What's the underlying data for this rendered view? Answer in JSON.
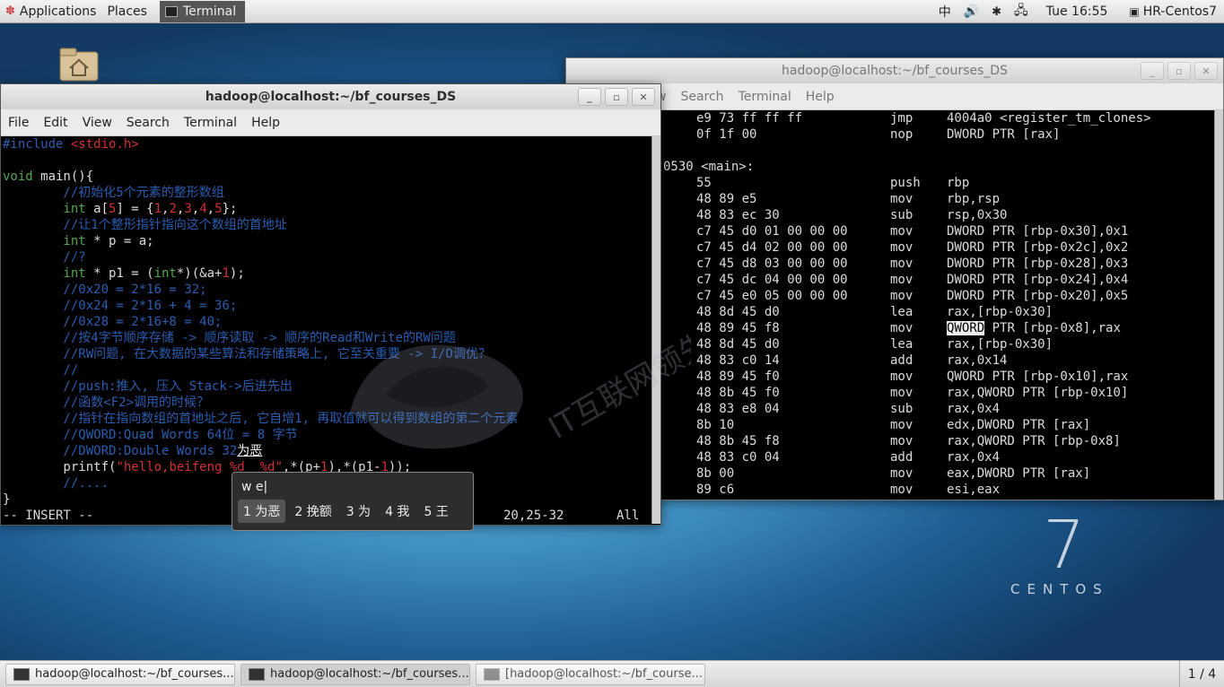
{
  "top_panel": {
    "applications": "Applications",
    "places": "Places",
    "terminal_tab": "Terminal",
    "input_method": "中",
    "clock": "Tue 16:55",
    "user": "HR-Centos7"
  },
  "back_window": {
    "title": "hadoop@localhost:~/bf_courses_DS",
    "menu": [
      "w",
      "Search",
      "Terminal",
      "Help"
    ],
    "rows": [
      {
        "addr": "",
        "bytes": "e9 73 ff ff ff",
        "op": "jmp",
        "args": "4004a0 <register_tm_clones>"
      },
      {
        "addr": "",
        "bytes": "0f 1f 00",
        "op": "nop",
        "args": "DWORD PTR [rax]"
      },
      {
        "addr": "",
        "bytes": "",
        "op": "",
        "args": ""
      },
      {
        "addr": "0530 <main>:",
        "bytes": "",
        "op": "",
        "args": ""
      },
      {
        "addr": "",
        "bytes": "55",
        "op": "push",
        "args": "rbp"
      },
      {
        "addr": "",
        "bytes": "48 89 e5",
        "op": "mov",
        "args": "rbp,rsp"
      },
      {
        "addr": "",
        "bytes": "48 83 ec 30",
        "op": "sub",
        "args": "rsp,0x30"
      },
      {
        "addr": "",
        "bytes": "c7 45 d0 01 00 00 00",
        "op": "mov",
        "args": "DWORD PTR [rbp-0x30],0x1"
      },
      {
        "addr": "",
        "bytes": "c7 45 d4 02 00 00 00",
        "op": "mov",
        "args": "DWORD PTR [rbp-0x2c],0x2"
      },
      {
        "addr": "",
        "bytes": "c7 45 d8 03 00 00 00",
        "op": "mov",
        "args": "DWORD PTR [rbp-0x28],0x3"
      },
      {
        "addr": "",
        "bytes": "c7 45 dc 04 00 00 00",
        "op": "mov",
        "args": "DWORD PTR [rbp-0x24],0x4"
      },
      {
        "addr": "",
        "bytes": "c7 45 e0 05 00 00 00",
        "op": "mov",
        "args": "DWORD PTR [rbp-0x20],0x5"
      },
      {
        "addr": "",
        "bytes": "48 8d 45 d0",
        "op": "lea",
        "args": "rax,[rbp-0x30]"
      },
      {
        "addr": "",
        "bytes": "48 89 45 f8",
        "op": "mov",
        "args_hl": "QWORD",
        "args": " PTR [rbp-0x8],rax"
      },
      {
        "addr": "",
        "bytes": "48 8d 45 d0",
        "op": "lea",
        "args": "rax,[rbp-0x30]"
      },
      {
        "addr": "",
        "bytes": "48 83 c0 14",
        "op": "add",
        "args": "rax,0x14"
      },
      {
        "addr": "",
        "bytes": "48 89 45 f0",
        "op": "mov",
        "args": "QWORD PTR [rbp-0x10],rax"
      },
      {
        "addr": "",
        "bytes": "48 8b 45 f0",
        "op": "mov",
        "args": "rax,QWORD PTR [rbp-0x10]"
      },
      {
        "addr": "",
        "bytes": "48 83 e8 04",
        "op": "sub",
        "args": "rax,0x4"
      },
      {
        "addr": "",
        "bytes": "8b 10",
        "op": "mov",
        "args": "edx,DWORD PTR [rax]"
      },
      {
        "addr": "",
        "bytes": "48 8b 45 f8",
        "op": "mov",
        "args": "rax,QWORD PTR [rbp-0x8]"
      },
      {
        "addr": "",
        "bytes": "48 83 c0 04",
        "op": "add",
        "args": "rax,0x4"
      },
      {
        "addr": "",
        "bytes": "8b 00",
        "op": "mov",
        "args": "eax,DWORD PTR [rax]"
      },
      {
        "addr": "",
        "bytes": "89 c6",
        "op": "mov",
        "args": "esi,eax"
      }
    ]
  },
  "front_window": {
    "title": "hadoop@localhost:~/bf_courses_DS",
    "menu": [
      "File",
      "Edit",
      "View",
      "Search",
      "Terminal",
      "Help"
    ],
    "lines": [
      [
        {
          "c": "k-com",
          "t": "#include "
        },
        {
          "c": "k-str",
          "t": "<stdio.h>"
        }
      ],
      [],
      [
        {
          "c": "k-type",
          "t": "void"
        },
        {
          "c": "",
          "t": " main(){"
        }
      ],
      [
        {
          "c": "k-com",
          "t": "        //初始化5个元素的整形数组"
        }
      ],
      [
        {
          "c": "k-type",
          "t": "        int"
        },
        {
          "c": "",
          "t": " a["
        },
        {
          "c": "k-num",
          "t": "5"
        },
        {
          "c": "",
          "t": "] = {"
        },
        {
          "c": "k-num",
          "t": "1"
        },
        {
          "c": "",
          "t": ","
        },
        {
          "c": "k-num",
          "t": "2"
        },
        {
          "c": "",
          "t": ","
        },
        {
          "c": "k-num",
          "t": "3"
        },
        {
          "c": "",
          "t": ","
        },
        {
          "c": "k-num",
          "t": "4"
        },
        {
          "c": "",
          "t": ","
        },
        {
          "c": "k-num",
          "t": "5"
        },
        {
          "c": "",
          "t": "};"
        }
      ],
      [
        {
          "c": "k-com",
          "t": "        //让1个整形指针指向这个数组的首地址"
        }
      ],
      [
        {
          "c": "k-type",
          "t": "        int"
        },
        {
          "c": "",
          "t": " * p = a;"
        }
      ],
      [
        {
          "c": "k-com",
          "t": "        //?"
        }
      ],
      [
        {
          "c": "k-type",
          "t": "        int"
        },
        {
          "c": "",
          "t": " * p1 = ("
        },
        {
          "c": "k-type",
          "t": "int"
        },
        {
          "c": "",
          "t": "*)(&a+"
        },
        {
          "c": "k-num",
          "t": "1"
        },
        {
          "c": "",
          "t": ");"
        }
      ],
      [
        {
          "c": "k-com",
          "t": "        //0x20 = 2*16 = 32;"
        }
      ],
      [
        {
          "c": "k-com",
          "t": "        //0x24 = 2*16 + 4 = 36;"
        }
      ],
      [
        {
          "c": "k-com",
          "t": "        //0x28 = 2*16+8 = 40;"
        }
      ],
      [
        {
          "c": "k-com",
          "t": "        //按4字节顺序存储 -> 顺序读取 -> 顺序的Read和Write的RW问题"
        }
      ],
      [
        {
          "c": "k-com",
          "t": "        //RW问题, 在大数据的某些算法和存储策略上, 它至关重要 -> I/O调优？"
        }
      ],
      [
        {
          "c": "k-com",
          "t": "        //"
        }
      ],
      [
        {
          "c": "k-com",
          "t": "        //push:推入, 压入 Stack->后进先出"
        }
      ],
      [
        {
          "c": "k-com",
          "t": "        //函数<F2>调用的时候？"
        }
      ],
      [
        {
          "c": "k-com",
          "t": "        //指针在指向数组的首地址之后, 它自增1, 再取值就可以得到数组的第二个元素"
        }
      ],
      [
        {
          "c": "k-com",
          "t": "        //QWORD:Quad Words 64位 = 8 字节"
        }
      ],
      [
        {
          "c": "k-com",
          "t": "        //DWORD:Double Words 32"
        },
        {
          "c": "",
          "t": "为恶"
        }
      ],
      [
        {
          "c": "",
          "t": "        printf("
        },
        {
          "c": "k-str",
          "t": "\"hello,beifeng %d  %d\""
        },
        {
          "c": "",
          "t": ",*(p+"
        },
        {
          "c": "k-num",
          "t": "1"
        },
        {
          "c": "",
          "t": "),*(p1-"
        },
        {
          "c": "k-num",
          "t": "1"
        },
        {
          "c": "",
          "t": "));"
        }
      ],
      [
        {
          "c": "k-com",
          "t": "        //...."
        }
      ],
      [
        {
          "c": "",
          "t": "}"
        }
      ]
    ],
    "mode": "-- INSERT --",
    "cursor_pos": "20,25-32",
    "scroll": "All"
  },
  "ime": {
    "preedit": "w e|",
    "candidates": [
      "1 为恶",
      "2 挽额",
      "3 为",
      "4 我",
      "5 王"
    ]
  },
  "watermark": {
    "text": "IT互联网领先品牌"
  },
  "centos": {
    "seven": "7",
    "word": "CENTOS"
  },
  "taskbar": {
    "items": [
      "hadoop@localhost:~/bf_courses...",
      "hadoop@localhost:~/bf_courses...",
      "[hadoop@localhost:~/bf_course..."
    ],
    "workspace": "1 / 4"
  },
  "colors": {
    "comment": "#2a5db0",
    "type": "#4ea84e",
    "string": "#d23131"
  }
}
